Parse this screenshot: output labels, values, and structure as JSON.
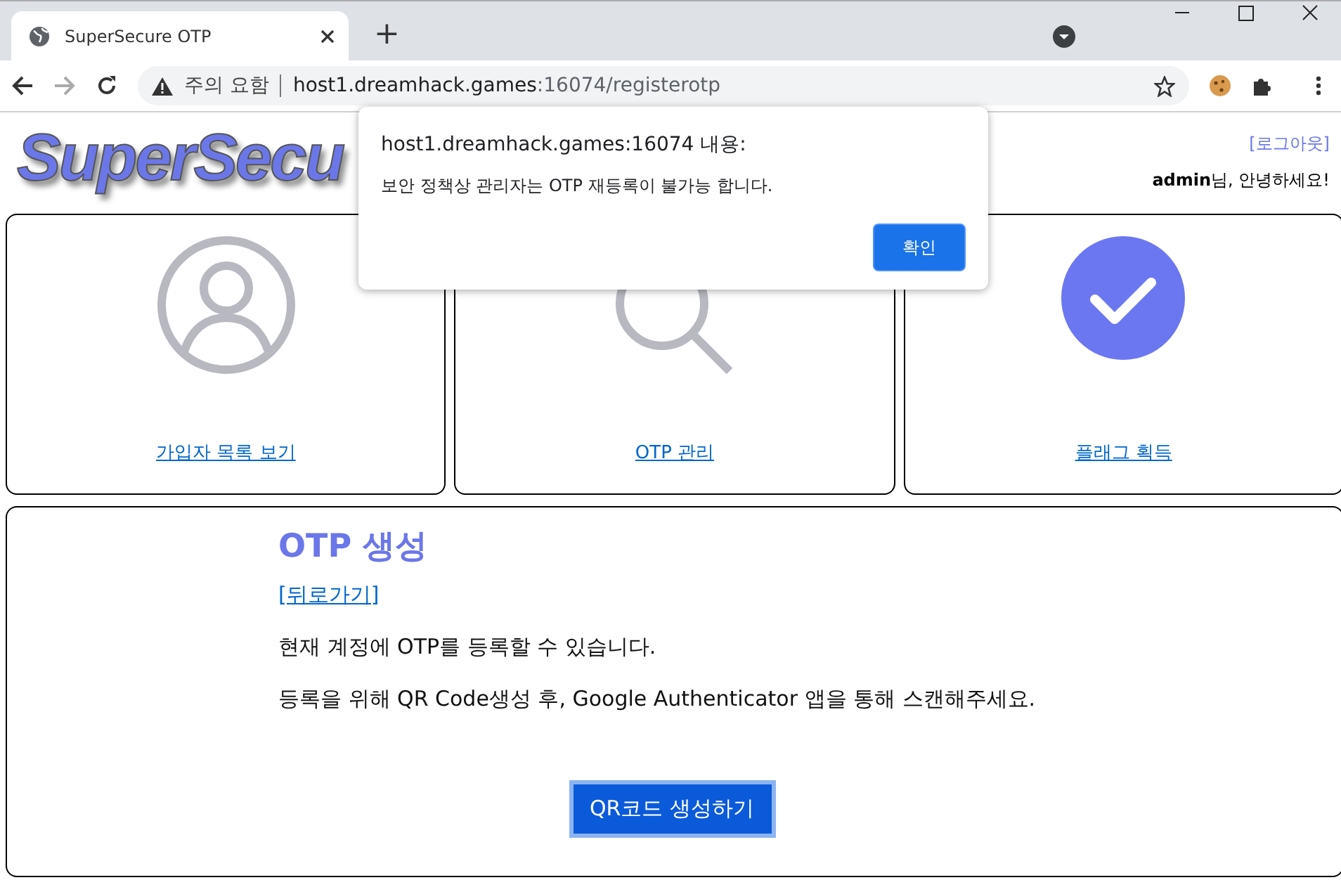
{
  "browser": {
    "tab_title": "SuperSecure OTP",
    "new_tab": "+",
    "security": "주의 요함",
    "url_host": "host1.dreamhack.games",
    "url_rest": ":16074/registerotp"
  },
  "header": {
    "logo": "SuperSecu",
    "logout": "[로그아웃]",
    "greeting": "**admin**님, 안녕하세요!"
  },
  "cards": [
    {
      "kind": "user",
      "label": "가입자 목록 보기"
    },
    {
      "kind": "search",
      "label": "OTP 관리"
    },
    {
      "kind": "check",
      "label": "플래그 획득"
    }
  ],
  "section": {
    "title": "OTP 생성",
    "back_link": "[뒤로가기]",
    "paragraphs": [
      "현재 계정에 OTP를 등록할 수 있습니다.",
      "등록을 위해 QR Code생성 후, Google Authenticator 앱을 통해 스캔해주세요."
    ],
    "button": "QR코드 생성하기"
  },
  "dialog": {
    "title": "host1.dreamhack.games:16074 내용:",
    "message": "보안 정책상 관리자는 OTP 재등록이 불가능 합니다.",
    "button": "확인"
  }
}
